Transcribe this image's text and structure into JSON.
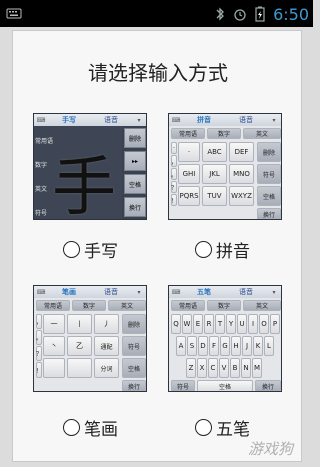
{
  "status": {
    "time": "6:50"
  },
  "title": "请选择输入方式",
  "watermark": "游戏狗",
  "options": [
    {
      "label": "手写",
      "tabs": [
        "手写",
        "语音"
      ],
      "handwriting": {
        "char": "手",
        "side": [
          "常用语",
          "数字",
          "英文",
          "符号"
        ],
        "keys": [
          "删除",
          "▸▸",
          "空格",
          "换行"
        ]
      }
    },
    {
      "label": "拼音",
      "tabs": [
        "拼音",
        "语音"
      ],
      "top_row": [
        "常用语",
        "数字",
        "英文"
      ],
      "rows": [
        [
          "·",
          "ABC",
          "DEF",
          "删除"
        ],
        [
          "GHI",
          "JKL",
          "MNO",
          "符号"
        ],
        [
          "PQRS",
          "TUV",
          "WXYZ",
          "空格"
        ]
      ],
      "left_col": [
        "·",
        "，",
        "。",
        "？",
        "！"
      ],
      "bottom_key": "换行"
    },
    {
      "label": "笔画",
      "tabs": [
        "笔画",
        "语音"
      ],
      "top_row": [
        "常用语",
        "数字",
        "英文"
      ],
      "rows": [
        [
          "一",
          "丨",
          "丿",
          "删除"
        ],
        [
          "丶",
          "乙",
          "通配",
          "符号"
        ],
        [
          "",
          "",
          "分词",
          "空格"
        ]
      ],
      "left_col": [
        "，",
        "。",
        "？",
        "！"
      ],
      "bottom_key": "换行"
    },
    {
      "label": "五笔",
      "tabs": [
        "五笔",
        "语音"
      ],
      "top_row": [
        "常用语",
        "数字",
        "英文"
      ],
      "qwerty": [
        [
          "Q",
          "W",
          "E",
          "R",
          "T",
          "Y",
          "U",
          "I",
          "O",
          "P"
        ],
        [
          "A",
          "S",
          "D",
          "F",
          "G",
          "H",
          "J",
          "K",
          "L"
        ],
        [
          "Z",
          "X",
          "C",
          "V",
          "B",
          "N",
          "M"
        ]
      ],
      "bottom": [
        "符号",
        "空格",
        "换行"
      ]
    }
  ]
}
